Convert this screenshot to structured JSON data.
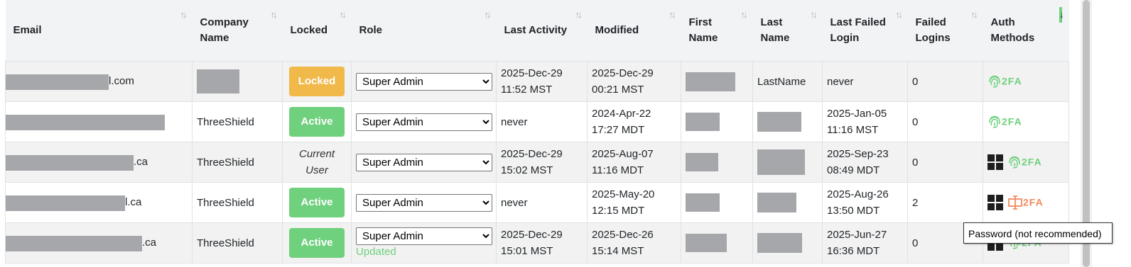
{
  "headers": [
    "Email",
    "Company Name",
    "Locked",
    "Role",
    "Last Activity",
    "Modified",
    "First Name",
    "Last Name",
    "Last Failed Login",
    "Failed Logins",
    "Auth Methods"
  ],
  "sort_icon": "↑↓",
  "sort_icon_active": "↓",
  "rows": [
    {
      "email_suffix": "l.com",
      "company": "",
      "status": "Locked",
      "role": "Super Admin",
      "role_note": "",
      "last_activity": [
        "2025-Dec-29",
        "11:52 MST"
      ],
      "modified": [
        "2025-Dec-29",
        "00:21 MST"
      ],
      "first_name": "",
      "last_name": "LastName",
      "last_failed": [
        "never",
        ""
      ],
      "failed_logins": "0",
      "auth": [
        "fingerprint"
      ]
    },
    {
      "email_suffix": "",
      "company": "ThreeShield",
      "status": "Active",
      "role": "Super Admin",
      "role_note": "",
      "last_activity": [
        "never",
        ""
      ],
      "modified": [
        "2024-Apr-22",
        "17:27 MDT"
      ],
      "first_name": "",
      "last_name": "",
      "last_failed": [
        "2025-Jan-05",
        "11:16 MST"
      ],
      "failed_logins": "0",
      "auth": [
        "fingerprint"
      ]
    },
    {
      "email_suffix": ".ca",
      "company": "ThreeShield",
      "status": "Current User",
      "role": "Super Admin",
      "role_note": "",
      "last_activity": [
        "2025-Dec-29",
        "15:02 MST"
      ],
      "modified": [
        "2025-Aug-07",
        "11:16 MDT"
      ],
      "first_name": "",
      "last_name": "",
      "last_failed": [
        "2025-Sep-23",
        "08:49 MDT"
      ],
      "failed_logins": "0",
      "auth": [
        "windows",
        "fingerprint"
      ]
    },
    {
      "email_suffix": "l.ca",
      "company": "ThreeShield",
      "status": "Active",
      "role": "Super Admin",
      "role_note": "",
      "last_activity": [
        "never",
        ""
      ],
      "modified": [
        "2025-May-20",
        "12:15 MDT"
      ],
      "first_name": "",
      "last_name": "",
      "last_failed": [
        "2025-Aug-26",
        "13:50 MDT"
      ],
      "failed_logins": "2",
      "auth": [
        "windows",
        "password"
      ]
    },
    {
      "email_suffix": ".ca",
      "company": "ThreeShield",
      "status": "Active",
      "role": "Super Admin",
      "role_note": "Updated",
      "last_activity": [
        "2025-Dec-29",
        "15:01 MST"
      ],
      "modified": [
        "2025-Dec-26",
        "15:14 MST"
      ],
      "first_name": "",
      "last_name": "",
      "last_failed": [
        "2025-Jun-27",
        "16:36 MDT"
      ],
      "failed_logins": "0",
      "auth": [
        "windows",
        "fingerprint"
      ]
    }
  ],
  "auth_label": "2FA",
  "role_options": [
    "Super Admin"
  ],
  "tooltip": "Password (not recommended)",
  "colors": {
    "locked": "#f0b94a",
    "active": "#6fd07d",
    "password": "#f08a5d",
    "windows": "#1e1e1e"
  }
}
